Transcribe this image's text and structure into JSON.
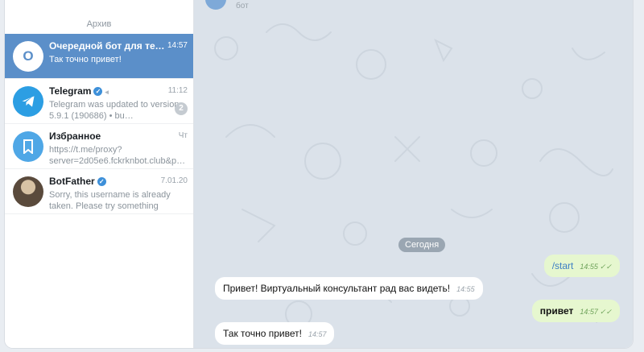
{
  "sidebar": {
    "archive_label": "Архив",
    "chats": [
      {
        "avatar_letter": "О",
        "title": "Очередной бот для теста",
        "time": "14:57",
        "preview": "Так точно привет!",
        "avatar_color": "#5b8fc9"
      },
      {
        "title": "Telegram",
        "time": "11:12",
        "preview": "Telegram was updated to version 5.9.1 (190686) • bu…",
        "badge": "2",
        "avatar_color": "#2c9ee3"
      },
      {
        "title": "Избранное",
        "time": "Чт",
        "preview": "https://t.me/proxy?server=2d05e6.fckrknbot.club&p…",
        "avatar_color": "#4fa7e6"
      },
      {
        "title": "BotFather",
        "time": "7.01.20",
        "preview": "Sorry, this username is already taken. Please try something differ…",
        "avatar_color": "#7a6a5a"
      }
    ]
  },
  "chat": {
    "header_fragment": "бот",
    "date_label": "Сегодня",
    "messages": [
      {
        "text": "/start",
        "time": "14:55",
        "checks": "✓✓"
      },
      {
        "text": "Привет! Виртуальный консультант рад вас видеть!",
        "time": "14:55"
      },
      {
        "text": "привет",
        "time": "14:57",
        "checks": "✓✓"
      },
      {
        "text": "Так точно привет!",
        "time": "14:57"
      }
    ]
  }
}
